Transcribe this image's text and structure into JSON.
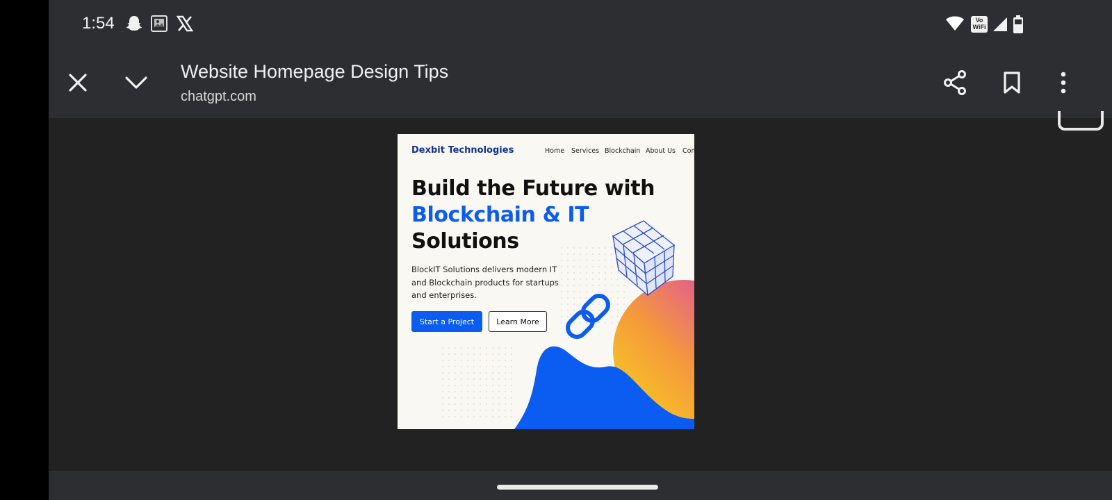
{
  "status_bar": {
    "time": "1:54",
    "left_icons": [
      "snapchat-icon",
      "gallery-notification-icon",
      "x-icon"
    ],
    "right_icons": [
      "wifi-icon",
      "vowifi-icon",
      "signal-icon",
      "battery-icon"
    ],
    "vowifi_text_top": "Vo",
    "vowifi_text_bottom": "WiFi"
  },
  "browser": {
    "page_title": "Website Homepage Design Tips",
    "url": "chatgpt.com"
  },
  "mockup": {
    "brand": "Dexbit Technologies",
    "nav": [
      "Home",
      "Services",
      "Blockchain",
      "About Us",
      "Con"
    ],
    "headline_line1": "Build the Future with",
    "headline_line2": "Blockchain & IT",
    "headline_line3": "Solutions",
    "description": "BlockIT Solutions delivers modern IT and Blockchain products for startups and enterprises.",
    "primary_button": "Start a Project",
    "secondary_button": "Learn More",
    "accent_color": "#0b5cf0"
  }
}
